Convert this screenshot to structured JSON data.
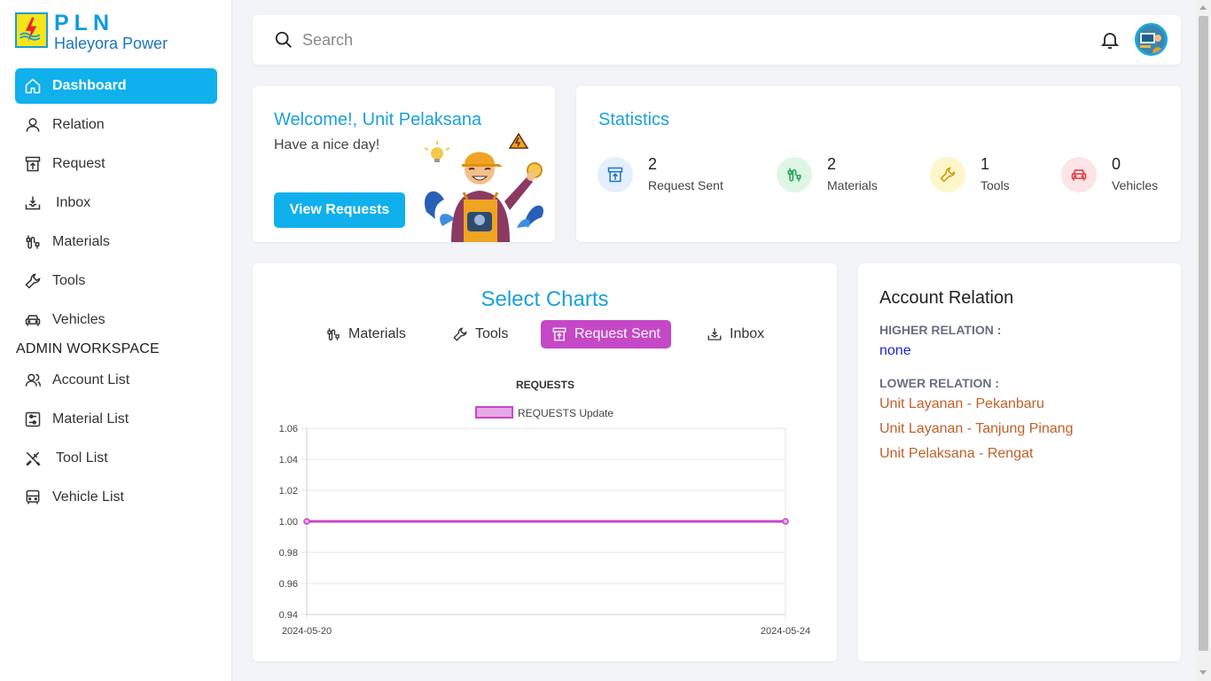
{
  "brand": {
    "title": "PLN",
    "subtitle": "Haleyora Power"
  },
  "sidebar": {
    "items": [
      {
        "label": "Dashboard",
        "icon": "home-icon",
        "active": true
      },
      {
        "label": "Relation",
        "icon": "user-icon"
      },
      {
        "label": "Request",
        "icon": "box-upload-icon"
      },
      {
        "label": "Inbox",
        "icon": "inbox-download-icon"
      },
      {
        "label": "Materials",
        "icon": "cable-icon"
      },
      {
        "label": "Tools",
        "icon": "wrench-icon"
      },
      {
        "label": "Vehicles",
        "icon": "car-icon"
      }
    ],
    "admin_heading": "ADMIN WORKSPACE",
    "admin_items": [
      {
        "label": "Account List",
        "icon": "users-icon"
      },
      {
        "label": "Material List",
        "icon": "sliders-box-icon"
      },
      {
        "label": "Tool List",
        "icon": "tools-cross-icon"
      },
      {
        "label": "Vehicle List",
        "icon": "bus-icon"
      }
    ]
  },
  "search": {
    "placeholder": "Search",
    "value": ""
  },
  "welcome": {
    "title": "Welcome!, Unit Pelaksana",
    "subtitle": "Have a nice day!",
    "button": "View Requests"
  },
  "statistics": {
    "title": "Statistics",
    "items": [
      {
        "value": "2",
        "label": "Request Sent",
        "icon": "box-upload-icon",
        "bg": "#e3effc",
        "fg": "#1e73c8"
      },
      {
        "value": "2",
        "label": "Materials",
        "icon": "cable-icon",
        "bg": "#ddf7e4",
        "fg": "#1ea34a"
      },
      {
        "value": "1",
        "label": "Tools",
        "icon": "wrench-icon",
        "bg": "#fdf6c9",
        "fg": "#c59a07"
      },
      {
        "value": "0",
        "label": "Vehicles",
        "icon": "car-icon",
        "bg": "#fde4e6",
        "fg": "#e0353f"
      }
    ]
  },
  "charts": {
    "title": "Select Charts",
    "tabs": [
      {
        "label": "Materials",
        "icon": "cable-icon"
      },
      {
        "label": "Tools",
        "icon": "wrench-icon"
      },
      {
        "label": "Request Sent",
        "icon": "box-upload-icon",
        "active": true
      },
      {
        "label": "Inbox",
        "icon": "inbox-download-icon"
      }
    ]
  },
  "chart_data": {
    "type": "line",
    "title": "REQUESTS",
    "x": [
      "2024-05-20",
      "2024-05-24"
    ],
    "series": [
      {
        "name": "REQUESTS Update",
        "values": [
          1.0,
          1.0
        ],
        "color": "#c548c6"
      }
    ],
    "ylim": [
      0.94,
      1.06
    ],
    "yticks": [
      "1.06",
      "1.04",
      "1.02",
      "1.00",
      "0.98",
      "0.96",
      "0.94"
    ],
    "grid": true,
    "legend": "top"
  },
  "relation": {
    "title": "Account Relation",
    "higher_label": "HIGHER RELATION :",
    "higher_value": "none",
    "lower_label": "LOWER RELATION :",
    "lower_items": [
      "Unit Layanan - Pekanbaru",
      "Unit Layanan - Tanjung Pinang",
      "Unit Pelaksana - Rengat"
    ]
  },
  "colors": {
    "accent": "#10b0ec",
    "chart_accent": "#c548c6",
    "relation_link": "#c2602a"
  }
}
